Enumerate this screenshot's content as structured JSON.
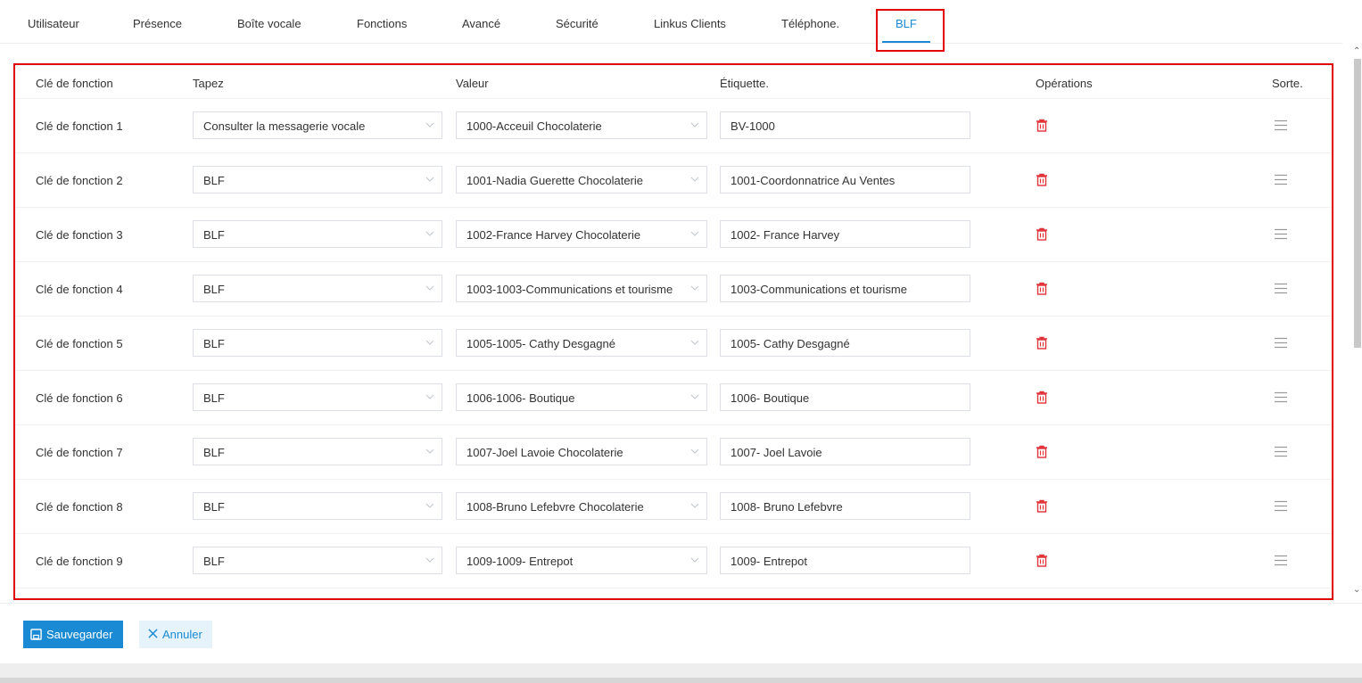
{
  "tabs": [
    {
      "label": "Utilisateur"
    },
    {
      "label": "Présence"
    },
    {
      "label": "Boîte vocale"
    },
    {
      "label": "Fonctions"
    },
    {
      "label": "Avancé"
    },
    {
      "label": "Sécurité"
    },
    {
      "label": "Linkus Clients"
    },
    {
      "label": "Téléphone."
    },
    {
      "label": "BLF",
      "active": true
    }
  ],
  "table": {
    "headers": {
      "key": "Clé de fonction",
      "type": "Tapez",
      "value": "Valeur",
      "label": "Étiquette.",
      "operations": "Opérations",
      "sort": "Sorte."
    },
    "rows": [
      {
        "key": "Clé de fonction 1",
        "type": "Consulter la messagerie vocale",
        "value": "1000-Acceuil Chocolaterie",
        "label": "BV-1000"
      },
      {
        "key": "Clé de fonction 2",
        "type": "BLF",
        "value": "1001-Nadia Guerette Chocolaterie",
        "label": "1001-Coordonnatrice Au Ventes"
      },
      {
        "key": "Clé de fonction 3",
        "type": "BLF",
        "value": "1002-France Harvey Chocolaterie",
        "label": "1002- France Harvey"
      },
      {
        "key": "Clé de fonction 4",
        "type": "BLF",
        "value": "1003-1003-Communications et tourisme",
        "label": "1003-Communications et tourisme"
      },
      {
        "key": "Clé de fonction 5",
        "type": "BLF",
        "value": "1005-1005- Cathy Desgagné",
        "label": "1005- Cathy Desgagné"
      },
      {
        "key": "Clé de fonction 6",
        "type": "BLF",
        "value": "1006-1006-  Boutique",
        "label": "1006-  Boutique"
      },
      {
        "key": "Clé de fonction 7",
        "type": "BLF",
        "value": "1007-Joel Lavoie Chocolaterie",
        "label": "1007- Joel Lavoie"
      },
      {
        "key": "Clé de fonction 8",
        "type": "BLF",
        "value": "1008-Bruno Lefebvre Chocolaterie",
        "label": "1008- Bruno Lefebvre"
      },
      {
        "key": "Clé de fonction 9",
        "type": "BLF",
        "value": "1009-1009- Entrepot",
        "label": "1009- Entrepot"
      }
    ]
  },
  "footer": {
    "save_label": "Sauvegarder",
    "cancel_label": "Annuler"
  },
  "icons": {
    "delete": "trash-icon",
    "sort": "drag-handle-icon",
    "dropdown": "chevron-down-icon",
    "save": "save-icon",
    "cancel": "close-icon"
  },
  "colors": {
    "accent": "#1a8ad4",
    "delete": "#e0343b",
    "highlight": "#e00000"
  }
}
